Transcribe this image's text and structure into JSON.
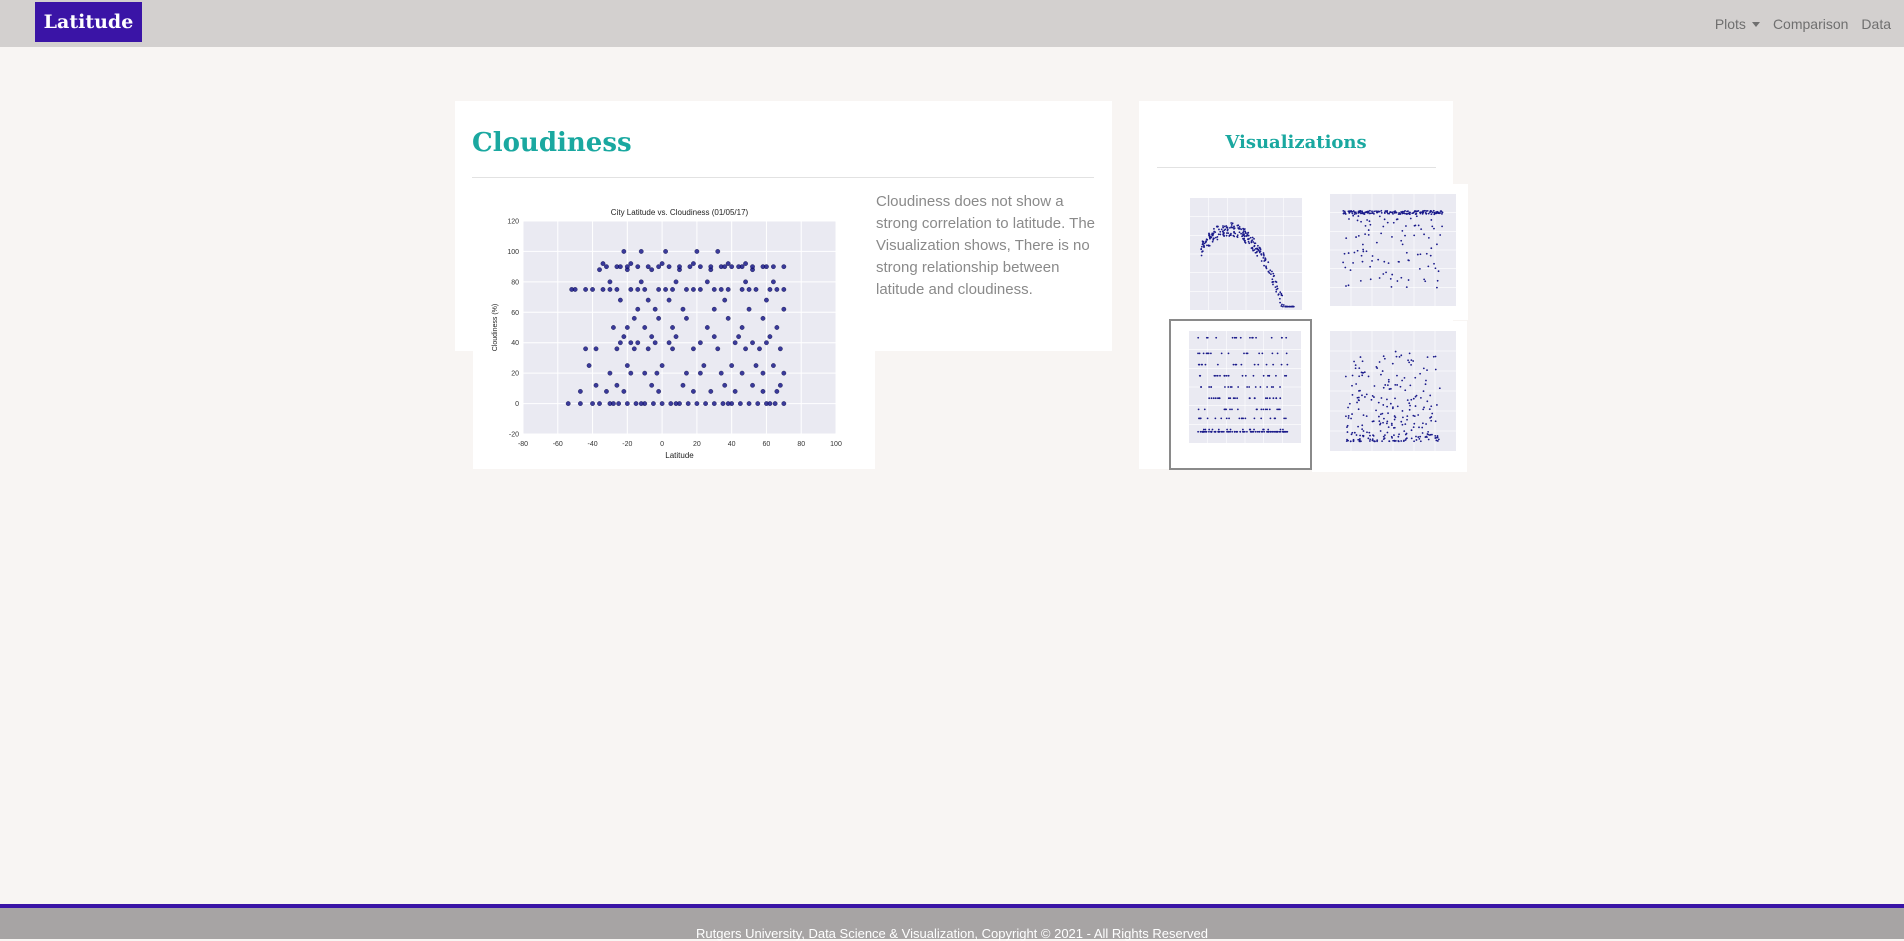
{
  "nav": {
    "brand": "Latitude",
    "links": [
      {
        "label": "Plots"
      },
      {
        "label": "Comparison"
      },
      {
        "label": "Data"
      }
    ]
  },
  "main": {
    "title": "Cloudiness",
    "description": "Cloudiness does not show a strong correlation to latitude. The Visualization shows, There is no strong relationship between latitude and cloudiness."
  },
  "sidebar": {
    "title": "Visualizations",
    "thumbnails": [
      {
        "name": "max-temperature-thumbnail"
      },
      {
        "name": "humidity-thumbnail"
      },
      {
        "name": "cloudiness-thumbnail"
      },
      {
        "name": "wind-speed-thumbnail"
      }
    ]
  },
  "colors": {
    "brand": "#3a14a6",
    "heading": "#1aa8a0",
    "marker": "#1a1a8a",
    "plot_bg": "#eaeaf2"
  },
  "chart_data": {
    "type": "scatter",
    "title": "City Latitude vs. Cloudiness (01/05/17)",
    "xlabel": "Latitude",
    "ylabel": "Cloudiness (%)",
    "xlim": [
      -80,
      100
    ],
    "ylim": [
      -20,
      120
    ],
    "xticks": [
      "-80",
      "-60",
      "-40",
      "-20",
      "0",
      "20",
      "40",
      "60",
      "80",
      "100"
    ],
    "yticks": [
      "-20",
      "0",
      "20",
      "40",
      "60",
      "80",
      "100",
      "120"
    ],
    "grid": true,
    "points": [
      [
        -54,
        0
      ],
      [
        -47,
        0
      ],
      [
        -40,
        0
      ],
      [
        -36,
        0
      ],
      [
        -30,
        0
      ],
      [
        -25,
        0
      ],
      [
        -20,
        0
      ],
      [
        -15,
        0
      ],
      [
        -10,
        0
      ],
      [
        -5,
        0
      ],
      [
        0,
        0
      ],
      [
        5,
        0
      ],
      [
        10,
        0
      ],
      [
        15,
        0
      ],
      [
        20,
        0
      ],
      [
        25,
        0
      ],
      [
        30,
        0
      ],
      [
        35,
        0
      ],
      [
        40,
        0
      ],
      [
        45,
        0
      ],
      [
        50,
        0
      ],
      [
        55,
        0
      ],
      [
        60,
        0
      ],
      [
        65,
        0
      ],
      [
        70,
        0
      ],
      [
        -28,
        0
      ],
      [
        -12,
        0
      ],
      [
        8,
        0
      ],
      [
        38,
        0
      ],
      [
        62,
        0
      ],
      [
        -47,
        8
      ],
      [
        -32,
        8
      ],
      [
        -22,
        8
      ],
      [
        -2,
        8
      ],
      [
        18,
        8
      ],
      [
        28,
        8
      ],
      [
        42,
        8
      ],
      [
        58,
        8
      ],
      [
        66,
        8
      ],
      [
        -38,
        12
      ],
      [
        -26,
        12
      ],
      [
        -6,
        12
      ],
      [
        12,
        12
      ],
      [
        36,
        12
      ],
      [
        52,
        12
      ],
      [
        68,
        12
      ],
      [
        -30,
        20
      ],
      [
        -18,
        20
      ],
      [
        -10,
        20
      ],
      [
        -3,
        20
      ],
      [
        14,
        20
      ],
      [
        22,
        20
      ],
      [
        34,
        20
      ],
      [
        46,
        20
      ],
      [
        58,
        20
      ],
      [
        70,
        20
      ],
      [
        -42,
        25
      ],
      [
        -20,
        25
      ],
      [
        0,
        25
      ],
      [
        24,
        25
      ],
      [
        40,
        25
      ],
      [
        54,
        25
      ],
      [
        64,
        25
      ],
      [
        -44,
        36
      ],
      [
        -38,
        36
      ],
      [
        -26,
        36
      ],
      [
        -16,
        36
      ],
      [
        -8,
        36
      ],
      [
        6,
        36
      ],
      [
        18,
        36
      ],
      [
        32,
        36
      ],
      [
        48,
        36
      ],
      [
        56,
        36
      ],
      [
        68,
        36
      ],
      [
        -24,
        40
      ],
      [
        -18,
        40
      ],
      [
        -14,
        40
      ],
      [
        -4,
        40
      ],
      [
        4,
        40
      ],
      [
        22,
        40
      ],
      [
        42,
        40
      ],
      [
        52,
        40
      ],
      [
        60,
        40
      ],
      [
        -22,
        44
      ],
      [
        -6,
        44
      ],
      [
        8,
        44
      ],
      [
        30,
        44
      ],
      [
        44,
        44
      ],
      [
        62,
        44
      ],
      [
        -28,
        50
      ],
      [
        -20,
        50
      ],
      [
        -10,
        50
      ],
      [
        6,
        50
      ],
      [
        26,
        50
      ],
      [
        46,
        50
      ],
      [
        66,
        50
      ],
      [
        -16,
        56
      ],
      [
        -2,
        56
      ],
      [
        14,
        56
      ],
      [
        38,
        56
      ],
      [
        58,
        56
      ],
      [
        -14,
        62
      ],
      [
        -4,
        62
      ],
      [
        12,
        62
      ],
      [
        30,
        62
      ],
      [
        50,
        62
      ],
      [
        70,
        62
      ],
      [
        -24,
        68
      ],
      [
        -8,
        68
      ],
      [
        4,
        68
      ],
      [
        36,
        68
      ],
      [
        60,
        68
      ],
      [
        -52,
        75
      ],
      [
        -44,
        75
      ],
      [
        -34,
        75
      ],
      [
        -26,
        75
      ],
      [
        -18,
        75
      ],
      [
        -10,
        75
      ],
      [
        -2,
        75
      ],
      [
        6,
        75
      ],
      [
        14,
        75
      ],
      [
        22,
        75
      ],
      [
        30,
        75
      ],
      [
        38,
        75
      ],
      [
        46,
        75
      ],
      [
        54,
        75
      ],
      [
        62,
        75
      ],
      [
        70,
        75
      ],
      [
        -50,
        75
      ],
      [
        -40,
        75
      ],
      [
        -30,
        75
      ],
      [
        -14,
        75
      ],
      [
        2,
        75
      ],
      [
        18,
        75
      ],
      [
        34,
        75
      ],
      [
        50,
        75
      ],
      [
        66,
        75
      ],
      [
        -30,
        80
      ],
      [
        -12,
        80
      ],
      [
        8,
        80
      ],
      [
        26,
        80
      ],
      [
        48,
        80
      ],
      [
        64,
        80
      ],
      [
        -36,
        88
      ],
      [
        -20,
        88
      ],
      [
        -6,
        88
      ],
      [
        10,
        88
      ],
      [
        28,
        88
      ],
      [
        52,
        88
      ],
      [
        -32,
        90
      ],
      [
        -26,
        90
      ],
      [
        -20,
        90
      ],
      [
        -14,
        90
      ],
      [
        -8,
        90
      ],
      [
        -2,
        90
      ],
      [
        4,
        90
      ],
      [
        10,
        90
      ],
      [
        16,
        90
      ],
      [
        22,
        90
      ],
      [
        28,
        90
      ],
      [
        34,
        90
      ],
      [
        40,
        90
      ],
      [
        46,
        90
      ],
      [
        52,
        90
      ],
      [
        58,
        90
      ],
      [
        64,
        90
      ],
      [
        70,
        90
      ],
      [
        -24,
        90
      ],
      [
        36,
        90
      ],
      [
        44,
        90
      ],
      [
        60,
        90
      ],
      [
        -34,
        92
      ],
      [
        -18,
        92
      ],
      [
        0,
        92
      ],
      [
        18,
        92
      ],
      [
        38,
        92
      ],
      [
        48,
        92
      ],
      [
        -22,
        100
      ],
      [
        -12,
        100
      ],
      [
        2,
        100
      ],
      [
        20,
        100
      ],
      [
        32,
        100
      ]
    ]
  }
}
